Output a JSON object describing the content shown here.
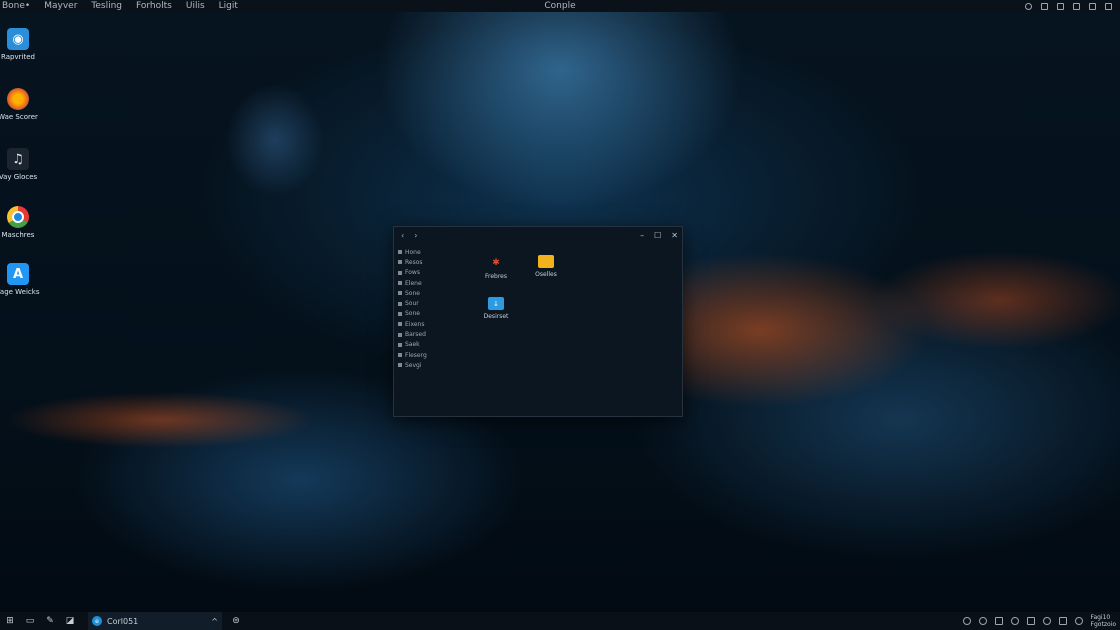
{
  "menubar": {
    "items": [
      "Bone•",
      "Mayver",
      "Tesling",
      "Forholts",
      "Uilis",
      "Ligit"
    ],
    "title": "Conple"
  },
  "desktop_icons": [
    {
      "label": "Rapvrited",
      "icon": "app-blue-icon",
      "color": "#2a8fd8"
    },
    {
      "label": "Wae Scorer",
      "icon": "firefox-icon",
      "color": "#e86a1e"
    },
    {
      "label": "Vay Gloces",
      "icon": "media-icon",
      "color": "#1c2430"
    },
    {
      "label": "Maschres",
      "icon": "chrome-icon",
      "color": "#e53935"
    },
    {
      "label": "Fage Weicks",
      "icon": "app-a-icon",
      "color": "#2196f3"
    }
  ],
  "window": {
    "nav": [
      "‹",
      "›"
    ],
    "sidebar": [
      "Hone",
      "Resos",
      "Fows",
      "Elene",
      "Sone",
      "Sour",
      "Sone",
      "Eixens",
      "Barsed",
      "Saek",
      "Fleserg",
      "Sevgi"
    ],
    "files": [
      {
        "label": "Frebres",
        "icon": "app-red-icon"
      },
      {
        "label": "Oselles",
        "icon": "folder-icon"
      },
      {
        "label": "Desirset",
        "icon": "blue-folder-icon"
      }
    ]
  },
  "taskbar": {
    "app_label": "Corl051",
    "clock_time": "Fagi10",
    "clock_date": "Fgotzoio"
  }
}
